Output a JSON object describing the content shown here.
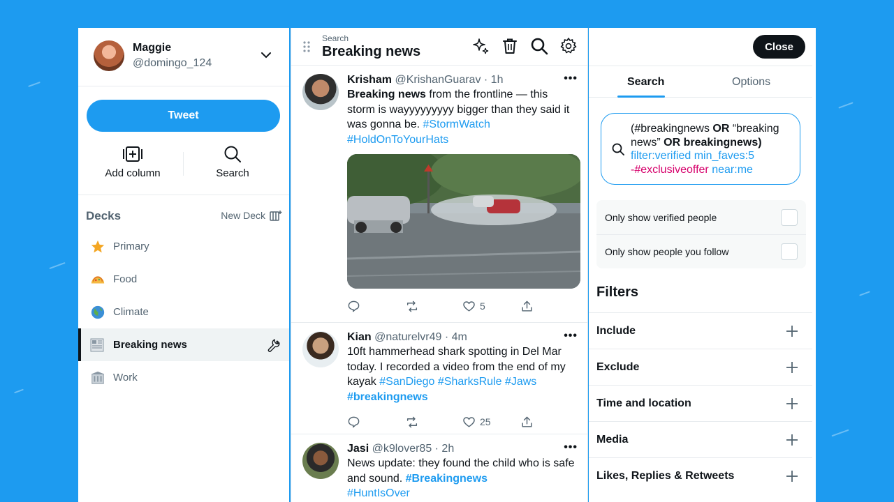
{
  "account": {
    "name": "Maggie",
    "handle": "@domingo_124"
  },
  "nav": {
    "tweet_label": "Tweet",
    "add_column_label": "Add column",
    "search_label": "Search",
    "decks_title": "Decks",
    "new_deck_label": "New Deck",
    "decks": [
      {
        "label": "Primary",
        "icon": "star-icon"
      },
      {
        "label": "Food",
        "icon": "taco-icon"
      },
      {
        "label": "Climate",
        "icon": "globe-icon"
      },
      {
        "label": "Breaking news",
        "icon": "newspaper-icon",
        "active": true
      },
      {
        "label": "Work",
        "icon": "office-building-icon"
      }
    ]
  },
  "column": {
    "subtitle": "Search",
    "title": "Breaking news",
    "tweets": [
      {
        "name": "Krisham",
        "meta": "@KrishanGuarav · 1h",
        "body_bold": "Breaking news",
        "body_text": " from the frontline — this storm is wayyyyyyyyy bigger than they said it was gonna be. ",
        "tags": [
          "#StormWatch",
          "#HoldOnToYourHats"
        ],
        "likes": "5"
      },
      {
        "name": "Kian",
        "meta": "@naturelvr49 · 4m",
        "body_text": "10ft hammerhead shark spotting in Del Mar today. I recorded a video from the end of my kayak ",
        "tags": [
          "#SanDiego",
          "#SharksRule",
          "#Jaws"
        ],
        "tag_bold": "#breakingnews",
        "likes": "25"
      },
      {
        "name": "Jasi",
        "meta": "@k9lover85 · 2h",
        "body_text": "News update: they found the child who is safe and sound. ",
        "tag_bold": "#Breakingnews",
        "tags": [
          "#HuntIsOver"
        ]
      }
    ]
  },
  "right": {
    "close_label": "Close",
    "tabs": [
      "Search",
      "Options"
    ],
    "query": {
      "p1": "(#breakingnews ",
      "or1": "OR",
      "p2": " “breaking news” ",
      "or2": "OR",
      "p3": " breakingnews)",
      "filter": "filter:verified min_faves:5",
      "exclude": "-#exclusiveoffer",
      "near": "near:me"
    },
    "options": [
      "Only show verified people",
      "Only show people you follow"
    ],
    "filters_title": "Filters",
    "filters": [
      "Include",
      "Exclude",
      "Time and location",
      "Media",
      "Likes, Replies & Retweets"
    ]
  },
  "colors": {
    "accent": "#1d9bf0",
    "background": "#1d9bf0",
    "pink": "#d6006b",
    "text": "#0f1419",
    "muted": "#536471"
  }
}
